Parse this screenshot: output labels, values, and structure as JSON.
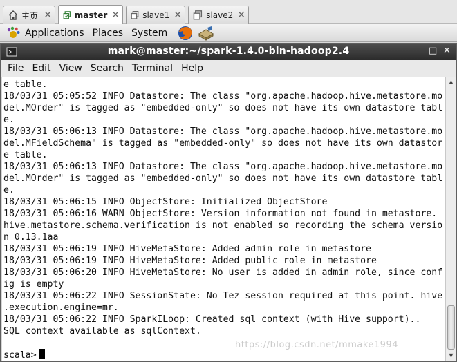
{
  "tabs": [
    {
      "label": "主页",
      "icon": "home-icon",
      "active": false
    },
    {
      "label": "master",
      "icon": "vm-icon",
      "active": true
    },
    {
      "label": "slave1",
      "icon": "vm-icon",
      "active": false
    },
    {
      "label": "slave2",
      "icon": "vm-icon",
      "active": false
    }
  ],
  "tab_close_glyph": "✕",
  "panel": {
    "applications": "Applications",
    "places": "Places",
    "system": "System"
  },
  "window": {
    "title": "mark@master:~/spark-1.4.0-bin-hadoop2.4",
    "minimize": "_",
    "maximize": "□",
    "close": "✕"
  },
  "menubar": [
    "File",
    "Edit",
    "View",
    "Search",
    "Terminal",
    "Help"
  ],
  "terminal": {
    "lines": [
      "e table.",
      "18/03/31 05:05:52 INFO Datastore: The class \"org.apache.hadoop.hive.metastore.mo",
      "del.MOrder\" is tagged as \"embedded-only\" so does not have its own datastore tabl",
      "e.",
      "18/03/31 05:06:13 INFO Datastore: The class \"org.apache.hadoop.hive.metastore.mo",
      "del.MFieldSchema\" is tagged as \"embedded-only\" so does not have its own datastor",
      "e table.",
      "18/03/31 05:06:13 INFO Datastore: The class \"org.apache.hadoop.hive.metastore.mo",
      "del.MOrder\" is tagged as \"embedded-only\" so does not have its own datastore tabl",
      "e.",
      "18/03/31 05:06:15 INFO ObjectStore: Initialized ObjectStore",
      "18/03/31 05:06:16 WARN ObjectStore: Version information not found in metastore.",
      "hive.metastore.schema.verification is not enabled so recording the schema versio",
      "n 0.13.1aa",
      "18/03/31 05:06:19 INFO HiveMetaStore: Added admin role in metastore",
      "18/03/31 05:06:19 INFO HiveMetaStore: Added public role in metastore",
      "18/03/31 05:06:20 INFO HiveMetaStore: No user is added in admin role, since conf",
      "ig is empty",
      "18/03/31 05:06:22 INFO SessionState: No Tez session required at this point. hive",
      ".execution.engine=mr.",
      "18/03/31 05:06:22 INFO SparkILoop: Created sql context (with Hive support)..",
      "SQL context available as sqlContext.",
      ""
    ],
    "prompt": "scala>"
  },
  "watermark": "https://blog.csdn.net/mmake1994",
  "colors": {
    "titlebar": "#3a3a3a",
    "terminal_bg": "#ffffff",
    "terminal_fg": "#111111"
  }
}
